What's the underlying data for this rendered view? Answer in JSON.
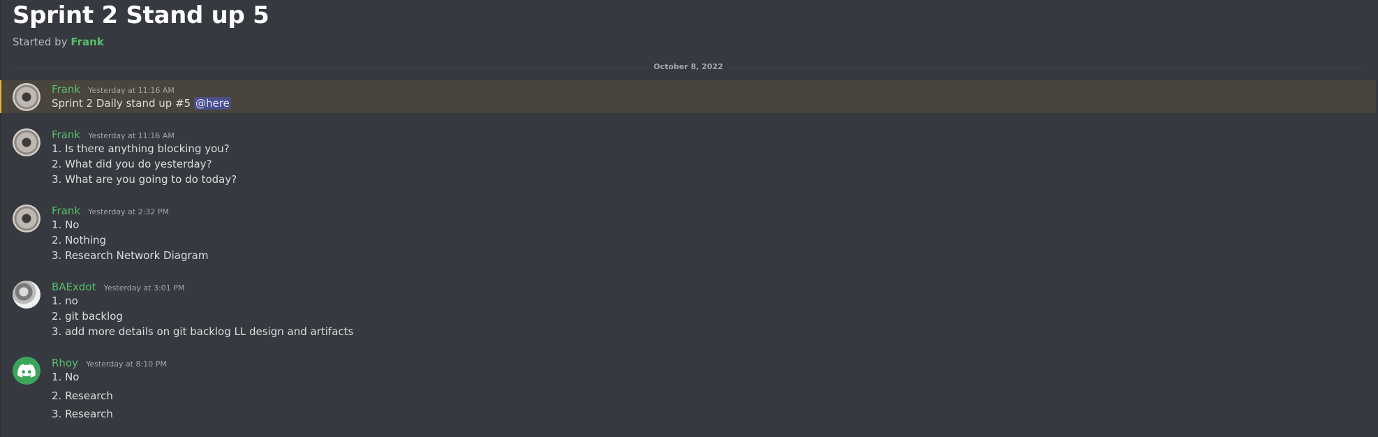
{
  "thread": {
    "title": "Sprint 2 Stand up 5",
    "started_by_prefix": "Started by",
    "started_by_name": "Frank"
  },
  "date_divider": "October 8, 2022",
  "messages": [
    {
      "author": "Frank",
      "timestamp": "Yesterday at 11:16 AM",
      "text": "Sprint 2 Daily stand up #5",
      "mention": "@here"
    },
    {
      "author": "Frank",
      "timestamp": "Yesterday at 11:16 AM",
      "lines": [
        "1. Is there anything blocking you?",
        "2. What did you do yesterday?",
        "3. What are you going to do today?"
      ]
    },
    {
      "author": "Frank",
      "timestamp": "Yesterday at 2:32 PM",
      "lines": [
        "1. No",
        "2. Nothing",
        "3. Research Network Diagram"
      ]
    },
    {
      "author": "BAExdot",
      "timestamp": "Yesterday at 3:01 PM",
      "lines": [
        "1. no",
        "2. git backlog",
        "3. add more details on git backlog LL design and artifacts"
      ]
    },
    {
      "author": "Rhoy",
      "timestamp": "Yesterday at 8:10 PM",
      "lines": [
        "1. No",
        "2. Research",
        "3. Research"
      ]
    }
  ],
  "colors": {
    "background": "#36393f",
    "username": "#57bf6e",
    "highlight": "#49443c",
    "highlight_bar": "#f0b232",
    "mention_bg": "#4a4f8a"
  },
  "icons": {
    "default_avatar": "discord-logo-icon"
  }
}
